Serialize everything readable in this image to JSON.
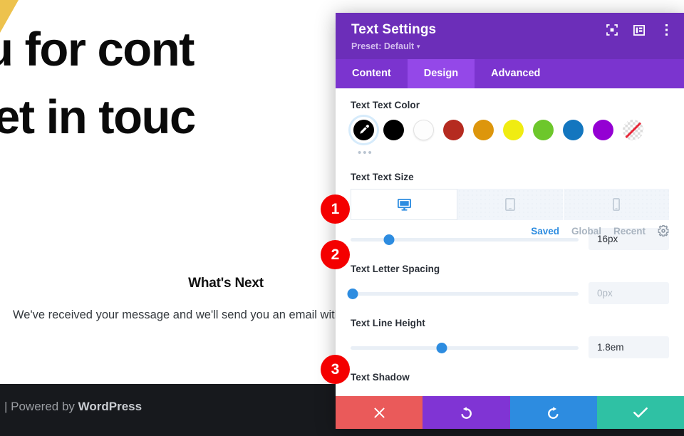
{
  "background_page": {
    "hero_lines": [
      "k you for cont",
      "e'll get in touc"
    ],
    "section_heading": "What's Next",
    "body_text": "We've received your message and we'll send you an email with",
    "footer_prefix": "| Powered by ",
    "footer_brand": "WordPress"
  },
  "modal": {
    "title": "Text Settings",
    "preset": "Preset: Default",
    "header_icons": [
      {
        "name": "focus-icon"
      },
      {
        "name": "layout-panel-icon"
      },
      {
        "name": "more-vertical-icon"
      }
    ],
    "tabs": [
      {
        "label": "Content",
        "active": false
      },
      {
        "label": "Design",
        "active": true
      },
      {
        "label": "Advanced",
        "active": false
      }
    ],
    "sections": {
      "text_color": {
        "label": "Text Text Color",
        "picker": {
          "name": "eyedropper-swatch",
          "color": "#000000",
          "selected": true
        },
        "swatches": [
          {
            "name": "swatch-black",
            "color": "#000000"
          },
          {
            "name": "swatch-white",
            "color": "#ffffff"
          },
          {
            "name": "swatch-dark-red",
            "color": "#b52b20"
          },
          {
            "name": "swatch-orange",
            "color": "#dd960c"
          },
          {
            "name": "swatch-yellow",
            "color": "#f0ec12"
          },
          {
            "name": "swatch-green",
            "color": "#6dc72b"
          },
          {
            "name": "swatch-blue",
            "color": "#1376bf"
          },
          {
            "name": "swatch-purple",
            "color": "#9400d3"
          },
          {
            "name": "swatch-transparent",
            "color": "transparent"
          }
        ],
        "more_dots": "•••",
        "palette_tabs": [
          {
            "label": "Saved",
            "active": true
          },
          {
            "label": "Global",
            "active": false
          },
          {
            "label": "Recent",
            "active": false
          }
        ],
        "settings_icon": "gear-icon"
      },
      "text_size": {
        "label": "Text Text Size",
        "devices": [
          {
            "name": "desktop",
            "icon": "desktop-icon",
            "active": true
          },
          {
            "name": "tablet",
            "icon": "tablet-icon",
            "active": false
          },
          {
            "name": "phone",
            "icon": "phone-icon",
            "active": false
          }
        ],
        "value": "16px",
        "slider_percent": 17
      },
      "letter_spacing": {
        "label": "Text Letter Spacing",
        "value": "0px",
        "is_placeholder": true,
        "slider_percent": 1
      },
      "line_height": {
        "label": "Text Line Height",
        "value": "1.8em",
        "is_placeholder": false,
        "slider_percent": 40
      },
      "next_section": {
        "label": "Text Shadow"
      }
    },
    "footer_buttons": [
      {
        "name": "cancel-button",
        "icon": "close-icon",
        "color": "#ea5a5a"
      },
      {
        "name": "undo-button",
        "icon": "undo-icon",
        "color": "#8034d4"
      },
      {
        "name": "redo-button",
        "icon": "redo-icon",
        "color": "#2d8ce0"
      },
      {
        "name": "save-button",
        "icon": "check-icon",
        "color": "#2fc1a4"
      }
    ]
  },
  "annotations": [
    {
      "number": "1"
    },
    {
      "number": "2"
    },
    {
      "number": "3"
    }
  ]
}
